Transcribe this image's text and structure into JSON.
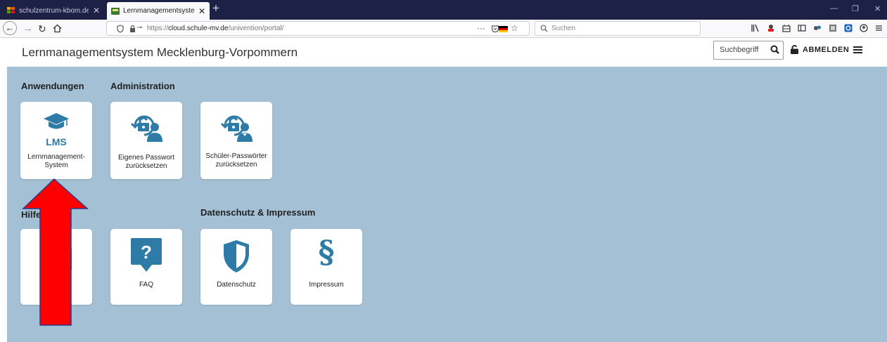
{
  "browser": {
    "tabs": [
      {
        "title": "schulzentrum-kbom.de - Admi",
        "close": "✕"
      },
      {
        "title": "Lernmanagementsystem Meckl",
        "close": "✕"
      }
    ],
    "new_tab": "+",
    "window_controls": {
      "minimize": "—",
      "restore": "❐",
      "close": "✕"
    },
    "url_scheme": "https://",
    "url_domain": "cloud.schule-mv.de",
    "url_path": "/univention/portal/",
    "url_menu": "···",
    "search_placeholder": "Suchen"
  },
  "portal": {
    "title": "Lernmanagementsystem Mecklenburg-Vorpommern",
    "search_placeholder": "Suchbegriff",
    "logout_label": "ABMELDEN"
  },
  "sections": {
    "anwendungen": "Anwendungen",
    "administration": "Administration",
    "hilfe": "Hilfe",
    "datenschutz": "Datenschutz & Impressum"
  },
  "tiles": {
    "lms": {
      "icon_text": "LMS",
      "line1": "Lernmanagement-",
      "line2": "System"
    },
    "passwort": {
      "line1": "Eigenes Passwort",
      "line2": "zurücksetzen"
    },
    "schueler": {
      "line1": "Schüler-Passwörter",
      "line2": "zurücksetzen"
    },
    "faq": {
      "icon_text": "?",
      "label": "FAQ"
    },
    "datenschutz": {
      "label": "Datenschutz"
    },
    "impressum": {
      "icon_text": "§",
      "label": "Impressum"
    }
  },
  "colors": {
    "portal_bg": "#a3c0d5",
    "icon_blue": "#2e7ba8",
    "arrow_red": "#ff0000",
    "tabbar_bg": "#1e2146"
  },
  "icons": [
    "graduation-cap-icon",
    "lock-reset-user-icon",
    "lock-reset-student-icon",
    "faq-bubble-icon",
    "shield-icon",
    "paragraph-icon",
    "search-icon",
    "padlock-icon",
    "hamburger-menu-icon"
  ]
}
